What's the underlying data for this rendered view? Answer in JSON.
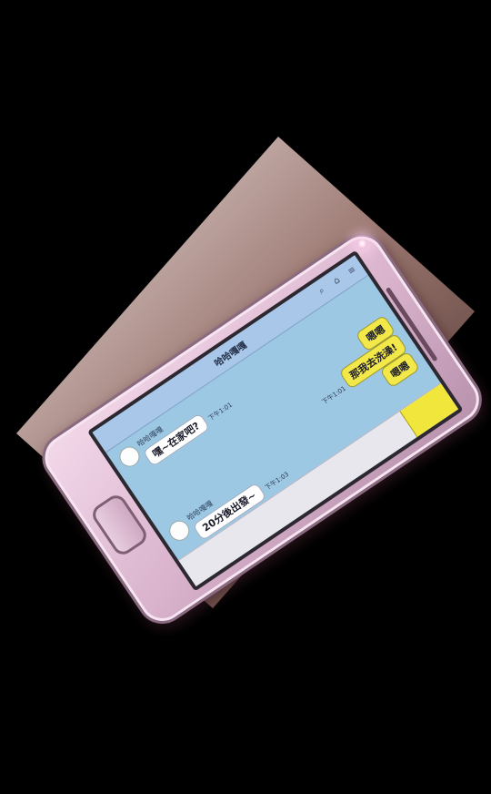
{
  "colors": {
    "background": "#000000",
    "phone": "#d9b2cc",
    "screen": "#9cc8e4",
    "incoming_bubble": "#ffffff",
    "outgoing_bubble": "#f2e84a",
    "input_button": "#f1e73c"
  },
  "chat": {
    "title": "哈哈嘎嘎",
    "icons": [
      "search-icon",
      "home-icon",
      "menu-icon"
    ],
    "messages": [
      {
        "sender": "哈哈嘎嘎",
        "text": "嘿~在家吧?",
        "time": "下午1:01",
        "side": "left"
      },
      {
        "sender": "",
        "text": "嗯嗯",
        "time": "",
        "side": "right"
      },
      {
        "sender": "",
        "text": "那我去洗澡!",
        "time": "下午1:01",
        "side": "right"
      },
      {
        "sender": "",
        "text": "嗯嗯",
        "time": "",
        "side": "right"
      },
      {
        "sender": "哈哈嘎嘎",
        "text": "20分後出發~",
        "time": "下午1:03",
        "side": "left"
      }
    ]
  }
}
